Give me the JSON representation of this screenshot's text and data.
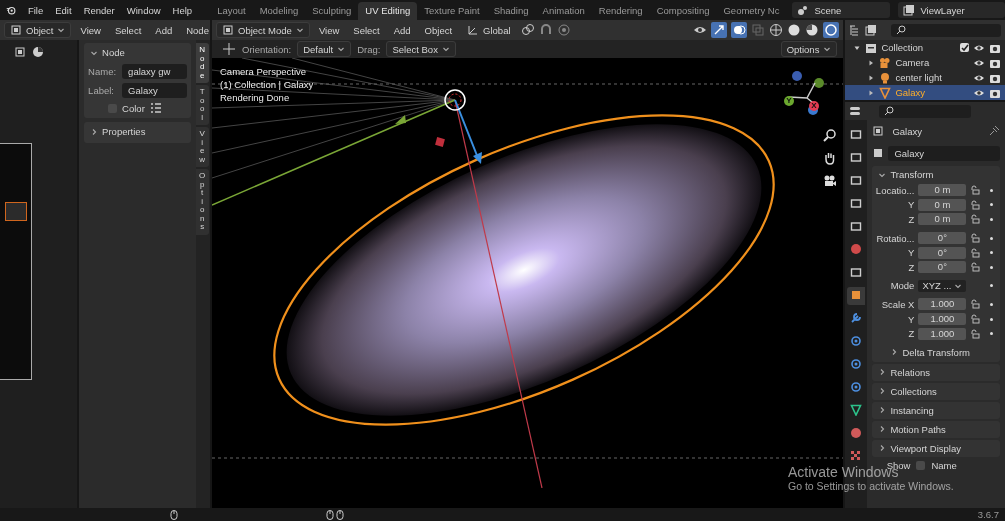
{
  "menu": [
    "File",
    "Edit",
    "Render",
    "Window",
    "Help"
  ],
  "workspaces": [
    {
      "label": "Layout",
      "selected": false
    },
    {
      "label": "Modeling",
      "selected": false
    },
    {
      "label": "Sculpting",
      "selected": false
    },
    {
      "label": "UV Editing",
      "selected": true
    },
    {
      "label": "Texture Paint",
      "selected": false
    },
    {
      "label": "Shading",
      "selected": false
    },
    {
      "label": "Animation",
      "selected": false
    },
    {
      "label": "Rendering",
      "selected": false
    },
    {
      "label": "Compositing",
      "selected": false
    },
    {
      "label": "Geometry Nc",
      "selected": false
    }
  ],
  "scene": "Scene",
  "view_layer": "ViewLayer",
  "node_editor": {
    "mode": "Object",
    "menus": [
      "View",
      "Select",
      "Add",
      "Node"
    ],
    "panel_title": "Node",
    "name_label": "Name:",
    "name": "galaxy gw",
    "label_label": "Label:",
    "label": "Galaxy",
    "color_label": "Color",
    "color_checked": false,
    "properties_title": "Properties",
    "tabs": [
      {
        "label": "Node",
        "selected": true
      },
      {
        "label": "Tool",
        "selected": false
      },
      {
        "label": "View",
        "selected": false
      },
      {
        "label": "Options",
        "selected": false
      }
    ]
  },
  "viewport": {
    "mode": "Object Mode",
    "menus": [
      "View",
      "Select",
      "Add",
      "Object"
    ],
    "transform_orientation": "Global",
    "orientation_label": "Orientation:",
    "orientation": "Default",
    "drag_label": "Drag:",
    "drag": "Select Box",
    "options": "Options",
    "overlay_text": [
      "Camera Perspective",
      "(1) Collection | Galaxy",
      "Rendering Done"
    ],
    "axes": [
      {
        "label": "Y",
        "color": "#6ba82f"
      },
      {
        "label": "X",
        "color": "#e23c52"
      }
    ]
  },
  "outliner": {
    "items": [
      {
        "name": "Collection",
        "kind": "collection",
        "checked": true,
        "selected": false,
        "children": [
          {
            "name": "Camera",
            "kind": "camera",
            "selected": false
          },
          {
            "name": "center light",
            "kind": "light",
            "selected": false
          },
          {
            "name": "Galaxy",
            "kind": "mesh",
            "selected": true
          }
        ]
      }
    ]
  },
  "properties": {
    "tabs": [
      {
        "kind": "tool",
        "selected": false
      },
      {
        "kind": "render",
        "selected": false
      },
      {
        "kind": "output",
        "selected": false
      },
      {
        "kind": "view_layer",
        "selected": false
      },
      {
        "kind": "scene",
        "selected": false
      },
      {
        "kind": "world",
        "selected": false
      },
      {
        "kind": "collection",
        "selected": false
      },
      {
        "kind": "object",
        "selected": true
      },
      {
        "kind": "modifiers",
        "selected": false
      },
      {
        "kind": "particles",
        "selected": false
      },
      {
        "kind": "physics",
        "selected": false
      },
      {
        "kind": "constraints",
        "selected": false
      },
      {
        "kind": "data",
        "selected": false
      },
      {
        "kind": "material",
        "selected": false
      },
      {
        "kind": "texture",
        "selected": false
      }
    ],
    "object_name": "Galaxy",
    "datablock": "Galaxy",
    "transform_title": "Transform",
    "rows": [
      {
        "kind": "field",
        "label": "Locatio...",
        "value": "0 m"
      },
      {
        "kind": "field",
        "label": "Y",
        "value": "0 m"
      },
      {
        "kind": "field",
        "label": "Z",
        "value": "0 m"
      },
      {
        "kind": "field",
        "label": "Rotatio...",
        "value": "0°"
      },
      {
        "kind": "field",
        "label": "Y",
        "value": "0°"
      },
      {
        "kind": "field",
        "label": "Z",
        "value": "0°"
      },
      {
        "kind": "mode",
        "label": "Mode",
        "value": "XYZ ..."
      },
      {
        "kind": "field",
        "label": "Scale X",
        "value": "1.000"
      },
      {
        "kind": "field",
        "label": "Y",
        "value": "1.000"
      },
      {
        "kind": "field",
        "label": "Z",
        "value": "1.000"
      }
    ],
    "subpanel": "Delta Transform",
    "panels": [
      "Relations",
      "Collections",
      "Instancing",
      "Motion Paths",
      "Viewport Display"
    ],
    "show_label": "Show",
    "name_label": "Name",
    "name_checked": false
  },
  "status_bar": {
    "version": "3.6.7"
  },
  "os_notice": {
    "title": "Activate Windows",
    "text": "Go to Settings to activate Windows."
  }
}
